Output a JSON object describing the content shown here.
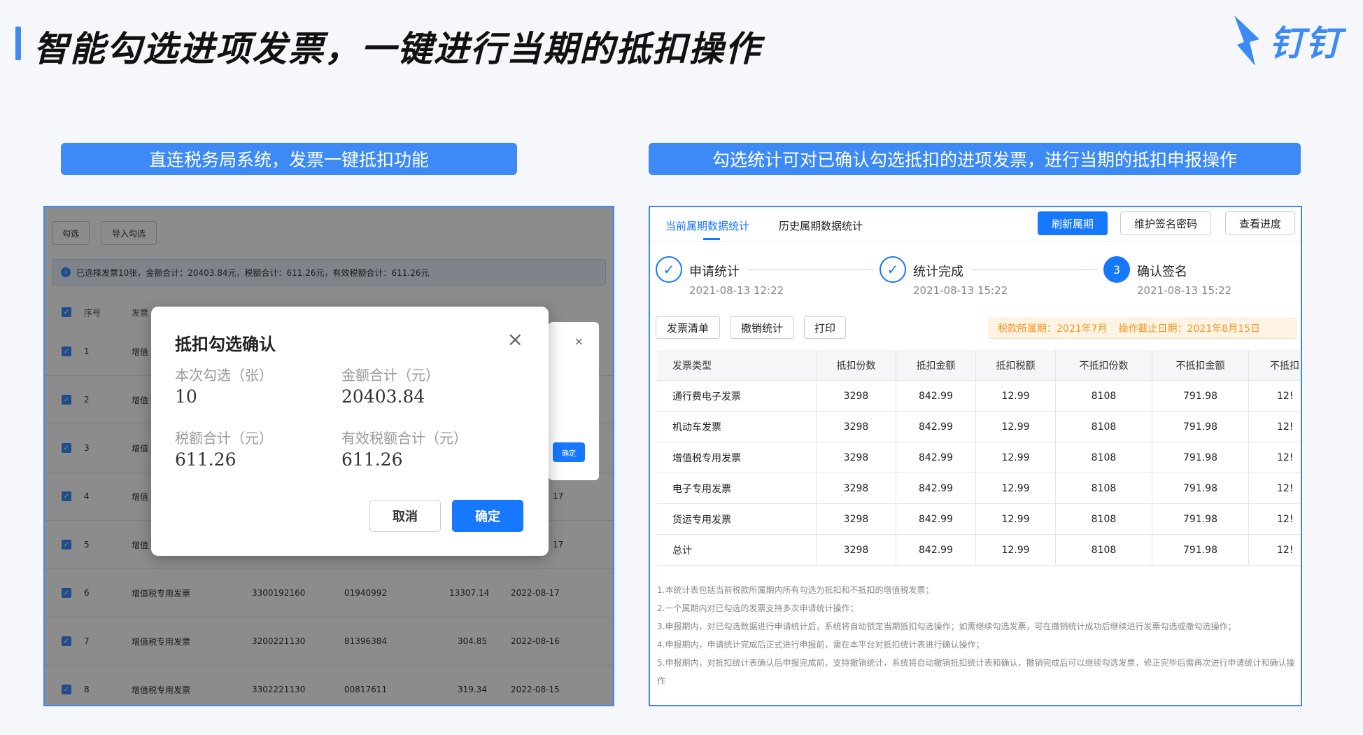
{
  "header": {
    "title": "智能勾选进项发票，一键进行当期的抵扣操作",
    "logo_text": "钉钉"
  },
  "labels": {
    "left": "直连税务局系统，发票一键抵扣功能",
    "right": "勾选统计可对已确认勾选抵扣的进项发票，进行当期的抵扣申报操作"
  },
  "left_panel": {
    "buttons": [
      "勾选",
      "导入勾选"
    ],
    "info": "已选择发票10张，金额合计：20403.84元，税额合计：611.26元，有效税额合计：611.26元",
    "columns": [
      "序号",
      "发票"
    ],
    "rows": [
      {
        "no": "1",
        "type": "增值",
        "code": "",
        "number": "",
        "amount": "",
        "date": ""
      },
      {
        "no": "2",
        "type": "增值",
        "code": "",
        "number": "",
        "amount": "",
        "date": ""
      },
      {
        "no": "3",
        "type": "增值",
        "code": "",
        "number": "",
        "amount": "",
        "date": ""
      },
      {
        "no": "4",
        "type": "增值",
        "code": "",
        "number": "",
        "amount": "",
        "date": "17"
      },
      {
        "no": "5",
        "type": "增值",
        "code": "",
        "number": "",
        "amount": "",
        "date": "17"
      },
      {
        "no": "6",
        "type": "增值税专用发票",
        "code": "3300192160",
        "number": "01940992",
        "amount": "13307.14",
        "date": "2022-08-17"
      },
      {
        "no": "7",
        "type": "增值税专用发票",
        "code": "3200221130",
        "number": "81396384",
        "amount": "304.85",
        "date": "2022-08-16"
      },
      {
        "no": "8",
        "type": "增值税专用发票",
        "code": "3302221130",
        "number": "00817611",
        "amount": "319.34",
        "date": "2022-08-15"
      }
    ],
    "back_dialog": {
      "close": "×",
      "ok": "确定"
    },
    "dialog": {
      "title": "抵扣勾选确认",
      "close": "×",
      "fields": [
        {
          "label": "本次勾选（张）",
          "value": "10"
        },
        {
          "label": "金额合计（元）",
          "value": "20403.84"
        },
        {
          "label": "税额合计（元）",
          "value": "611.26"
        },
        {
          "label": "有效税额合计（元）",
          "value": "611.26"
        }
      ],
      "cancel": "取消",
      "ok": "确定"
    }
  },
  "right_panel": {
    "tabs": [
      "当前属期数据统计",
      "历史属期数据统计"
    ],
    "buttons": [
      "刷新属期",
      "维护签名密码",
      "查看进度"
    ],
    "steps": [
      {
        "title": "申请统计",
        "time": "2021-08-13 12:22",
        "icon": "✓"
      },
      {
        "title": "统计完成",
        "time": "2021-08-13 15:22",
        "icon": "✓"
      },
      {
        "title": "确认签名",
        "time": "2021-08-13 15:22",
        "icon": "3"
      }
    ],
    "actions": [
      "发票清单",
      "撤销统计",
      "打印"
    ],
    "warn_period": "税款所属期：2021年7月",
    "warn_deadline": "操作截止日期：2021年8月15日",
    "columns": [
      "发票类型",
      "抵扣份数",
      "抵扣金额",
      "抵扣税额",
      "不抵扣份数",
      "不抵扣金额",
      "不抵扣"
    ],
    "rows": [
      [
        "通行费电子发票",
        "3298",
        "842.99",
        "12.99",
        "8108",
        "791.98",
        "12!"
      ],
      [
        "机动车发票",
        "3298",
        "842.99",
        "12.99",
        "8108",
        "791.98",
        "12!"
      ],
      [
        "增值税专用发票",
        "3298",
        "842.99",
        "12.99",
        "8108",
        "791.98",
        "12!"
      ],
      [
        "电子专用发票",
        "3298",
        "842.99",
        "12.99",
        "8108",
        "791.98",
        "12!"
      ],
      [
        "货运专用发票",
        "3298",
        "842.99",
        "12.99",
        "8108",
        "791.98",
        "12!"
      ],
      [
        "总计",
        "3298",
        "842.99",
        "12.99",
        "8108",
        "791.98",
        "12!"
      ]
    ],
    "notes": [
      "1.本统计表包括当前税款所属期内所有勾选为抵扣和不抵扣的增值税发票；",
      "2.一个属期内对已勾选的发票支持多次申请统计操作；",
      "3.申报期内，对已勾选数据进行申请统计后，系统将自动锁定当期抵扣勾选操作；如需继续勾选发票，可在撤销统计成功后继续进行发票勾选或撤勾选操作；",
      "4.申报期内，申请统计完成后正式进行申报前，需在本平台对抵扣统计表进行确认操作；",
      "5.申报期内，对抵扣统计表确认后申报完成前，支持撤销统计，系统将自动撤销抵扣统计表和确认，撤销完成后可以继续勾选发票，修正完毕后需再次进行申请统计和确认操作"
    ]
  }
}
